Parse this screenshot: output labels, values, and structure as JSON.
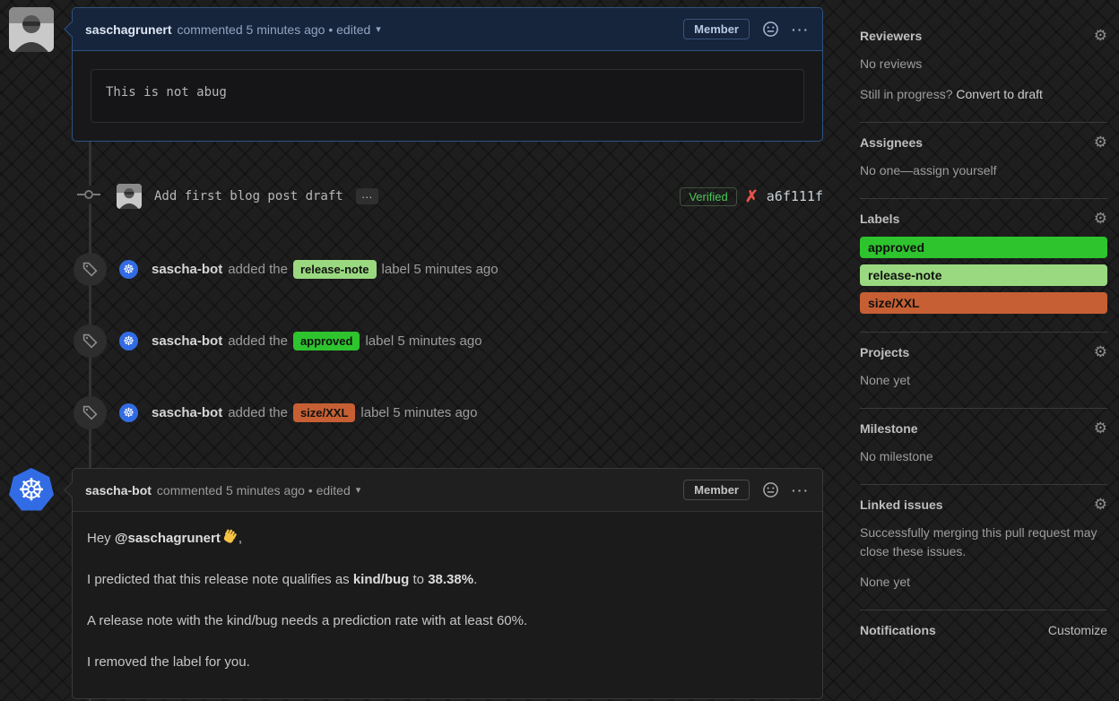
{
  "icons": {
    "gear": "⚙",
    "caret_down": "▾",
    "kebab": "···",
    "wheel": "☸",
    "cross": "✗",
    "expander": "…"
  },
  "comment1": {
    "author": "saschagrunert",
    "meta": "commented 5 minutes ago • edited",
    "member_badge": "Member",
    "body_code": "This is not abug"
  },
  "commit": {
    "message": "Add first blog post draft",
    "verified_badge": "Verified",
    "sha": "a6f111f"
  },
  "events": [
    {
      "actor": "sascha-bot",
      "action": "added the",
      "label": "release-note",
      "label_color": "#9ad980",
      "suffix": "label 5 minutes ago"
    },
    {
      "actor": "sascha-bot",
      "action": "added the",
      "label": "approved",
      "label_color": "#2dc42d",
      "suffix": "label 5 minutes ago"
    },
    {
      "actor": "sascha-bot",
      "action": "added the",
      "label": "size/XXL",
      "label_color": "#c65f33",
      "suffix": "label 5 minutes ago"
    }
  ],
  "comment2": {
    "author": "sascha-bot",
    "meta": "commented 5 minutes ago • edited",
    "member_badge": "Member",
    "p1_prefix": "Hey ",
    "p1_mention": "@saschagrunert",
    "p1_suffix": ",",
    "p2_prefix": "I predicted that this release note qualifies as ",
    "p2_bold1": "kind/bug",
    "p2_mid": " to ",
    "p2_bold2": "38.38%",
    "p2_suffix": ".",
    "p3": "A release note with the kind/bug needs a prediction rate with at least 60%.",
    "p4": "I removed the label for you."
  },
  "sidebar": {
    "reviewers": {
      "title": "Reviewers",
      "empty": "No reviews",
      "hint_prefix": "Still in progress? ",
      "hint_link": "Convert to draft"
    },
    "assignees": {
      "title": "Assignees",
      "empty_prefix": "No one—",
      "empty_link": "assign yourself"
    },
    "labels": {
      "title": "Labels",
      "items": [
        {
          "name": "approved",
          "color": "#2dc42d"
        },
        {
          "name": "release-note",
          "color": "#9ad980"
        },
        {
          "name": "size/XXL",
          "color": "#c65f33"
        }
      ]
    },
    "projects": {
      "title": "Projects",
      "empty": "None yet"
    },
    "milestone": {
      "title": "Milestone",
      "empty": "No milestone"
    },
    "linked_issues": {
      "title": "Linked issues",
      "description": "Successfully merging this pull request may close these issues.",
      "empty": "None yet"
    },
    "notifications": {
      "title": "Notifications",
      "action": "Customize"
    }
  }
}
